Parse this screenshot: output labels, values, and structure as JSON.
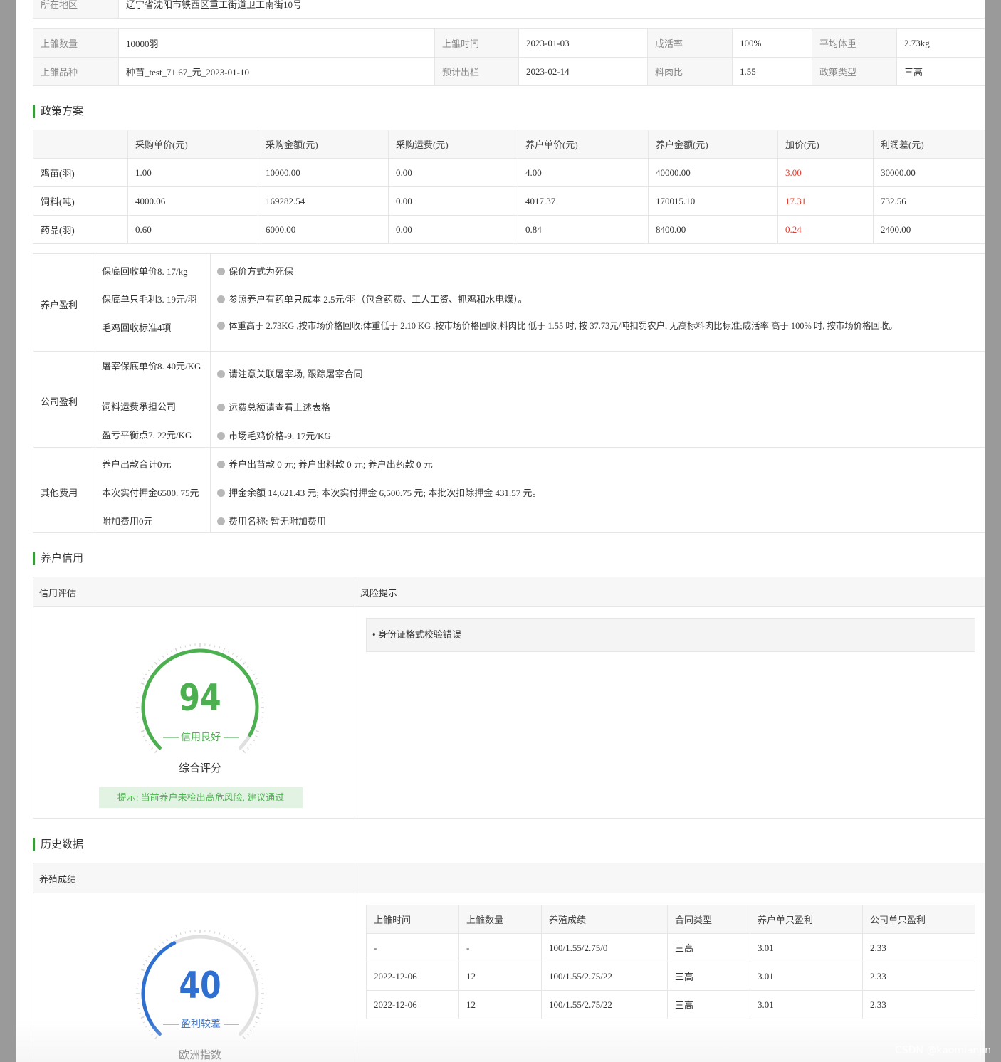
{
  "region": {
    "label": "所在地区",
    "value": "辽宁省沈阳市铁西区重工街道卫工南街10号"
  },
  "batch": {
    "row1": [
      {
        "label": "上雏数量",
        "value": "10000羽"
      },
      {
        "label": "上雏时间",
        "value": "2023-01-03"
      },
      {
        "label": "成活率",
        "value": "100%"
      },
      {
        "label": "平均体重",
        "value": "2.73kg"
      }
    ],
    "row2": [
      {
        "label": "上雏品种",
        "value": "种苗_test_71.67_元_2023-01-10"
      },
      {
        "label": "预计出栏",
        "value": "2023-02-14"
      },
      {
        "label": "料肉比",
        "value": "1.55"
      },
      {
        "label": "政策类型",
        "value": "三高"
      }
    ]
  },
  "policy": {
    "title": "政策方案",
    "headers": [
      "",
      "采购单价(元)",
      "采购金额(元)",
      "采购运费(元)",
      "养户单价(元)",
      "养户金额(元)",
      "加价(元)",
      "利润差(元)"
    ],
    "rows": [
      [
        "鸡苗(羽)",
        "1.00",
        "10000.00",
        "0.00",
        "4.00",
        "40000.00",
        "3.00",
        "30000.00"
      ],
      [
        "饲料(吨)",
        "4000.06",
        "169282.54",
        "0.00",
        "4017.37",
        "170015.10",
        "17.31",
        "732.56"
      ],
      [
        "药品(羽)",
        "0.60",
        "6000.00",
        "0.00",
        "0.84",
        "8400.00",
        "0.24",
        "2400.00"
      ]
    ],
    "accent_color": "#e23b2e"
  },
  "profit": {
    "groups": [
      {
        "name": "养户盈利",
        "items": [
          "保底回收单价8. 17/kg",
          "保底单只毛利3. 19元/羽",
          "毛鸡回收标准4项"
        ],
        "notes": [
          "保价方式为死保",
          "参照养户有药单只成本 2.5元/羽（包含药费、工人工资、抓鸡和水电煤）。",
          "体重高于 2.73KG ,按市场价格回收;体重低于 2.10 KG ,按市场价格回收;料肉比 低于 1.55 时, 按 37.73元/吨扣罚农户, 无高标料肉比标准;成活率 高于 100% 时, 按市场价格回收。"
        ]
      },
      {
        "name": "公司盈利",
        "items": [
          "屠宰保底单价8. 40元/KG",
          "饲料运费承担公司",
          "盈亏平衡点7. 22元/KG"
        ],
        "notes": [
          "请注意关联屠宰场, 跟踪屠宰合同",
          "运费总额请查看上述表格",
          "市场毛鸡价格-9. 17元/KG"
        ]
      },
      {
        "name": "其他费用",
        "items": [
          "养户出款合计0元",
          "本次实付押金6500. 75元",
          "附加费用0元"
        ],
        "notes": [
          "养户出苗款 0 元; 养户出料款 0 元; 养户出药款 0 元",
          "押金余额 14,621.43 元; 本次实付押金 6,500.75 元;  本批次扣除押金 431.57 元。",
          "费用名称: 暂无附加费用"
        ]
      }
    ]
  },
  "credit": {
    "title": "养户信用",
    "eval_header": "信用评估",
    "risk_header": "风险提示",
    "score": "94",
    "score_value": 94,
    "score_label": "信用良好",
    "caption": "综合评分",
    "tip": "提示: 当前养户未检出高危风险, 建议通过",
    "risks": [
      "身份证格式校验错误"
    ],
    "color": "#4caf50"
  },
  "history": {
    "title": "历史数据",
    "perf_header": "养殖成绩",
    "score": "40",
    "score_value": 40,
    "score_label": "盈利较差",
    "caption": "欧洲指数",
    "color": "#2e6fcf",
    "headers": [
      "上雏时间",
      "上雏数量",
      "养殖成绩",
      "合同类型",
      "养户单只盈利",
      "公司单只盈利"
    ],
    "rows": [
      [
        "-",
        "-",
        "100/1.55/2.75/0",
        "三高",
        "3.01",
        "2.33"
      ],
      [
        "2022-12-06",
        "12",
        "100/1.55/2.75/22",
        "三高",
        "3.01",
        "2.33"
      ],
      [
        "2022-12-06",
        "12",
        "100/1.55/2.75/22",
        "三高",
        "3.01",
        "2.33"
      ]
    ]
  },
  "watermark": "CSDN @kaomianjin"
}
